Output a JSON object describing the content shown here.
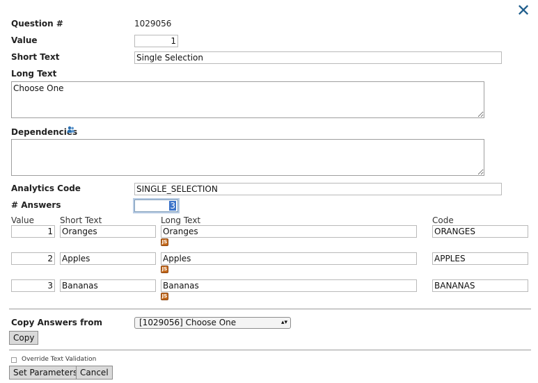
{
  "form": {
    "question_label": "Question #",
    "question_value": "1029056",
    "value_label": "Value",
    "value": "1",
    "short_text_label": "Short Text",
    "short_text": "Single Selection",
    "long_text_label": "Long Text",
    "long_text": "Choose One",
    "dependencies_label": "Dependencies",
    "dependencies": "",
    "analytics_label": "Analytics Code",
    "analytics_code": "SINGLE_SELECTION",
    "answers_label": "# Answers",
    "answers_count": "3"
  },
  "answers_table": {
    "headers": {
      "value": "Value",
      "short_text": "Short Text",
      "long_text": "Long Text",
      "code": "Code"
    },
    "rows": [
      {
        "value": "1",
        "short_text": "Oranges",
        "long_text": "Oranges",
        "code": "ORANGES"
      },
      {
        "value": "2",
        "short_text": "Apples",
        "long_text": "Apples",
        "code": "APPLES"
      },
      {
        "value": "3",
        "short_text": "Bananas",
        "long_text": "Bananas",
        "code": "BANANAS"
      }
    ],
    "js_icon": "javascript-icon"
  },
  "copy": {
    "label": "Copy Answers from",
    "selected": "[1029056] Choose One",
    "button": "Copy"
  },
  "options": {
    "override_label": "Override Text Validation",
    "override_checked": false
  },
  "footer": {
    "set_parameters": "Set Parameters",
    "cancel": "Cancel"
  },
  "icons": {
    "close": "close-icon",
    "dependencies": "users-icon"
  },
  "colors": {
    "close": "#1f5e8c",
    "selection": "#3b73c9"
  }
}
